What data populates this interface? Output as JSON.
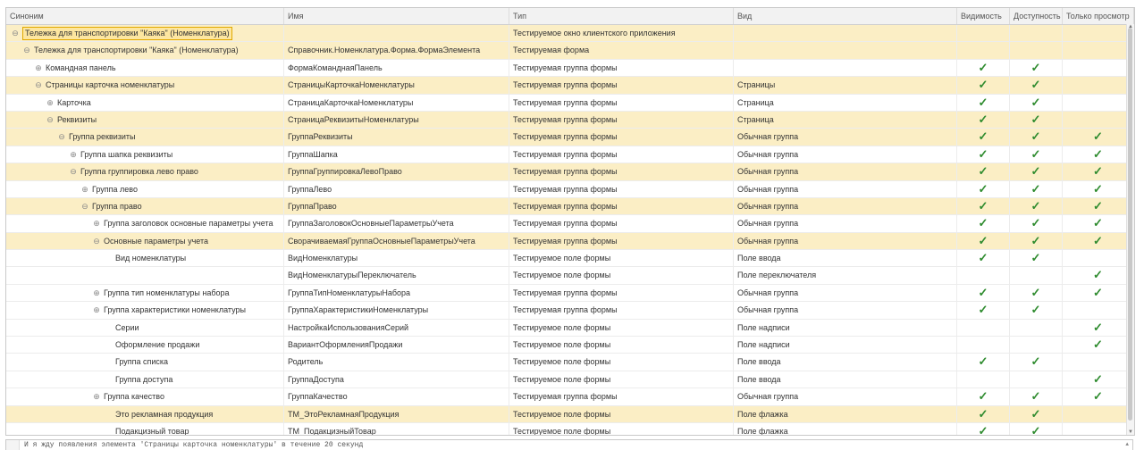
{
  "columns": [
    "Синоним",
    "Имя",
    "Тип",
    "Вид",
    "Видимость",
    "Доступность",
    "Только просмотр"
  ],
  "check_glyph": "✓",
  "colors": {
    "highlight": "#fbeec5",
    "check": "#2e8b2e",
    "selection_border": "#e0a800"
  },
  "rows": [
    {
      "syn": "Тележка для транспортировки \"Каяка\" (Номенклатура)",
      "name": "",
      "type": "Тестируемое окно клиентского приложения",
      "view": "",
      "vis": false,
      "acc": false,
      "ro": false,
      "level": 0,
      "toggle": "minus",
      "hl": true,
      "selected": true
    },
    {
      "syn": "Тележка для транспортировки \"Каяка\" (Номенклатура)",
      "name": "Справочник.Номенклатура.Форма.ФормаЭлемента",
      "type": "Тестируемая форма",
      "view": "",
      "vis": false,
      "acc": false,
      "ro": false,
      "level": 1,
      "toggle": "minus",
      "hl": true
    },
    {
      "syn": "Командная панель",
      "name": "ФормаКоманднаяПанель",
      "type": "Тестируемая группа формы",
      "view": "",
      "vis": true,
      "acc": true,
      "ro": false,
      "level": 2,
      "toggle": "plus",
      "hl": false
    },
    {
      "syn": "Страницы карточка номенклатуры",
      "name": "СтраницыКарточкаНоменклатуры",
      "type": "Тестируемая группа формы",
      "view": "Страницы",
      "vis": true,
      "acc": true,
      "ro": false,
      "level": 2,
      "toggle": "minus",
      "hl": true
    },
    {
      "syn": "Карточка",
      "name": "СтраницаКарточкаНоменклатуры",
      "type": "Тестируемая группа формы",
      "view": "Страница",
      "vis": true,
      "acc": true,
      "ro": false,
      "level": 3,
      "toggle": "plus",
      "hl": false
    },
    {
      "syn": "Реквизиты",
      "name": "СтраницаРеквизитыНоменклатуры",
      "type": "Тестируемая группа формы",
      "view": "Страница",
      "vis": true,
      "acc": true,
      "ro": false,
      "level": 3,
      "toggle": "minus",
      "hl": true
    },
    {
      "syn": "Группа реквизиты",
      "name": "ГруппаРеквизиты",
      "type": "Тестируемая группа формы",
      "view": "Обычная группа",
      "vis": true,
      "acc": true,
      "ro": true,
      "level": 4,
      "toggle": "minus",
      "hl": true
    },
    {
      "syn": "Группа шапка реквизиты",
      "name": "ГруппаШапка",
      "type": "Тестируемая группа формы",
      "view": "Обычная группа",
      "vis": true,
      "acc": true,
      "ro": true,
      "level": 5,
      "toggle": "plus",
      "hl": false
    },
    {
      "syn": "Группа группировка лево право",
      "name": "ГруппаГруппировкаЛевоПраво",
      "type": "Тестируемая группа формы",
      "view": "Обычная группа",
      "vis": true,
      "acc": true,
      "ro": true,
      "level": 5,
      "toggle": "minus",
      "hl": true
    },
    {
      "syn": "Группа лево",
      "name": "ГруппаЛево",
      "type": "Тестируемая группа формы",
      "view": "Обычная группа",
      "vis": true,
      "acc": true,
      "ro": true,
      "level": 6,
      "toggle": "plus",
      "hl": false
    },
    {
      "syn": "Группа право",
      "name": "ГруппаПраво",
      "type": "Тестируемая группа формы",
      "view": "Обычная группа",
      "vis": true,
      "acc": true,
      "ro": true,
      "level": 6,
      "toggle": "minus",
      "hl": true
    },
    {
      "syn": "Группа заголовок основные параметры учета",
      "name": "ГруппаЗаголовокОсновныеПараметрыУчета",
      "type": "Тестируемая группа формы",
      "view": "Обычная группа",
      "vis": true,
      "acc": true,
      "ro": true,
      "level": 7,
      "toggle": "plus",
      "hl": false
    },
    {
      "syn": "Основные параметры учета",
      "name": "СворачиваемаяГруппаОсновныеПараметрыУчета",
      "type": "Тестируемая группа формы",
      "view": "Обычная группа",
      "vis": true,
      "acc": true,
      "ro": true,
      "level": 7,
      "toggle": "minus",
      "hl": true
    },
    {
      "syn": "Вид номенклатуры",
      "name": "ВидНоменклатуры",
      "type": "Тестируемое поле формы",
      "view": "Поле ввода",
      "vis": true,
      "acc": true,
      "ro": false,
      "level": 8,
      "toggle": "none",
      "hl": false
    },
    {
      "syn": "",
      "name": "ВидНоменклатурыПереключатель",
      "type": "Тестируемое поле формы",
      "view": "Поле переключателя",
      "vis": false,
      "acc": false,
      "ro": true,
      "level": 8,
      "toggle": "none",
      "hl": false
    },
    {
      "syn": "Группа тип номенклатуры набора",
      "name": "ГруппаТипНоменклатурыНабора",
      "type": "Тестируемая группа формы",
      "view": "Обычная группа",
      "vis": true,
      "acc": true,
      "ro": true,
      "level": 7,
      "toggle": "plus",
      "hl": false
    },
    {
      "syn": "Группа характеристики номенклатуры",
      "name": "ГруппаХарактеристикиНоменклатуры",
      "type": "Тестируемая группа формы",
      "view": "Обычная группа",
      "vis": true,
      "acc": true,
      "ro": false,
      "level": 7,
      "toggle": "plus",
      "hl": false
    },
    {
      "syn": "Серии",
      "name": "НастройкаИспользованияСерий",
      "type": "Тестируемое поле формы",
      "view": "Поле надписи",
      "vis": false,
      "acc": false,
      "ro": true,
      "level": 8,
      "toggle": "none",
      "hl": false
    },
    {
      "syn": "Оформление продажи",
      "name": "ВариантОформленияПродажи",
      "type": "Тестируемое поле формы",
      "view": "Поле надписи",
      "vis": false,
      "acc": false,
      "ro": true,
      "level": 8,
      "toggle": "none",
      "hl": false
    },
    {
      "syn": "Группа списка",
      "name": "Родитель",
      "type": "Тестируемое поле формы",
      "view": "Поле ввода",
      "vis": true,
      "acc": true,
      "ro": false,
      "level": 8,
      "toggle": "none",
      "hl": false
    },
    {
      "syn": "Группа доступа",
      "name": "ГруппаДоступа",
      "type": "Тестируемое поле формы",
      "view": "Поле ввода",
      "vis": false,
      "acc": false,
      "ro": true,
      "level": 8,
      "toggle": "none",
      "hl": false
    },
    {
      "syn": "Группа качество",
      "name": "ГруппаКачество",
      "type": "Тестируемая группа формы",
      "view": "Обычная группа",
      "vis": true,
      "acc": true,
      "ro": true,
      "level": 7,
      "toggle": "plus",
      "hl": false
    },
    {
      "syn": "Это рекламная продукция",
      "name": "ТМ_ЭтоРекламнаяПродукция",
      "type": "Тестируемое поле формы",
      "view": "Поле флажка",
      "vis": true,
      "acc": true,
      "ro": false,
      "level": 8,
      "toggle": "none",
      "hl": true
    },
    {
      "syn": "Подакцизный товар",
      "name": "ТМ_ПодакцизныйТовар",
      "type": "Тестируемое поле формы",
      "view": "Поле флажка",
      "vis": true,
      "acc": true,
      "ro": false,
      "level": 8,
      "toggle": "none",
      "hl": false
    }
  ],
  "message": "И я жду появления элемента 'Страницы карточка номенклатуры' в течение 20 секунд"
}
